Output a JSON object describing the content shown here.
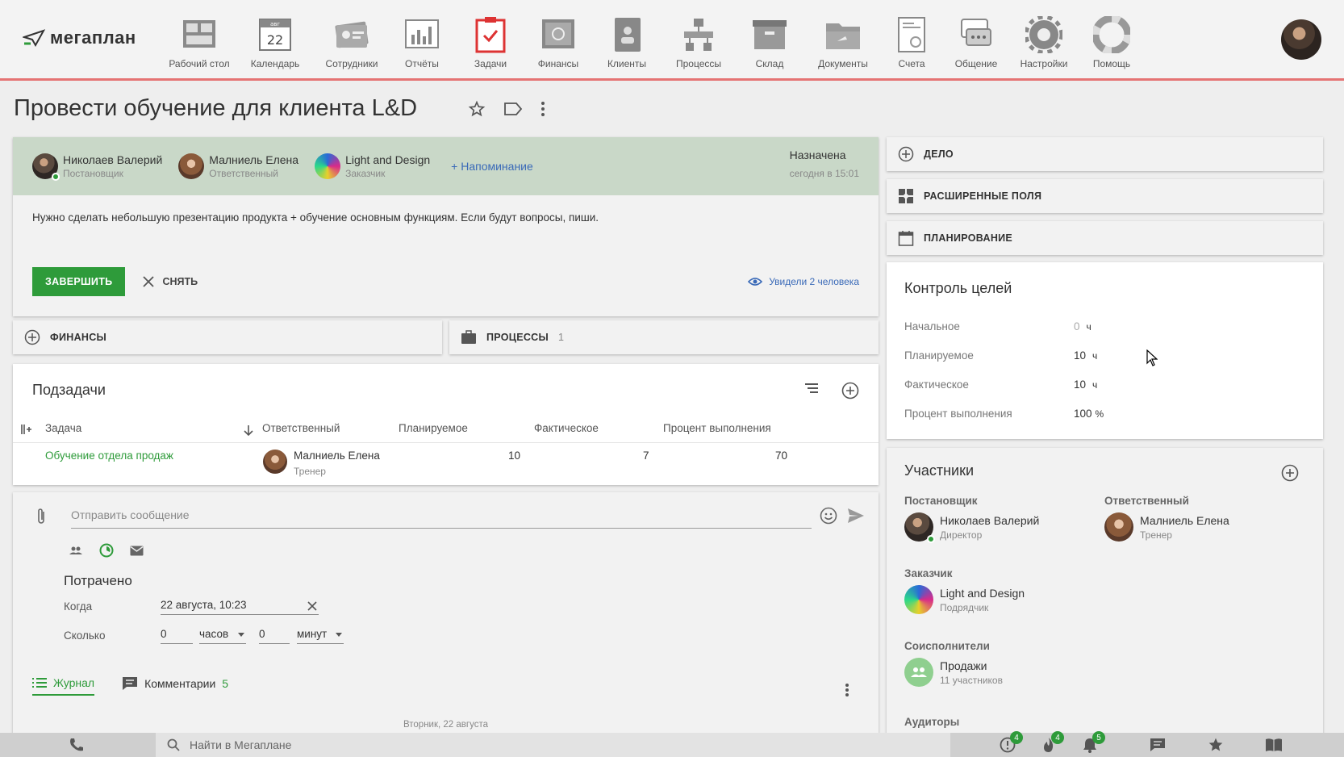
{
  "brand": {
    "logo_text": "мегаплан"
  },
  "nav": [
    {
      "label": "Рабочий стол",
      "icon": "desktop-icon"
    },
    {
      "label": "Календарь",
      "icon": "calendar-icon",
      "cal_month": "авг",
      "cal_day": "22"
    },
    {
      "label": "Сотрудники",
      "icon": "employees-icon"
    },
    {
      "label": "Отчёты",
      "icon": "reports-icon"
    },
    {
      "label": "Задачи",
      "icon": "tasks-icon"
    },
    {
      "label": "Финансы",
      "icon": "finance-icon"
    },
    {
      "label": "Клиенты",
      "icon": "clients-icon"
    },
    {
      "label": "Процессы",
      "icon": "processes-icon"
    },
    {
      "label": "Склад",
      "icon": "warehouse-icon"
    },
    {
      "label": "Документы",
      "icon": "documents-icon"
    },
    {
      "label": "Счета",
      "icon": "invoices-icon"
    },
    {
      "label": "Общение",
      "icon": "chat-icon"
    },
    {
      "label": "Настройки",
      "icon": "settings-icon"
    },
    {
      "label": "Помощь",
      "icon": "help-icon"
    }
  ],
  "page": {
    "title": "Провести обучение для клиента L&D"
  },
  "task": {
    "people": [
      {
        "name": "Николаев Валерий",
        "role": "Постановщик",
        "online": true
      },
      {
        "name": "Малниель Елена",
        "role": "Ответственный"
      },
      {
        "name": "Light and Design",
        "role": "Заказчик"
      }
    ],
    "reminder": "+ Напоминание",
    "status": "Назначена",
    "status_time": "сегодня в 15:01",
    "description": "Нужно сделать небольшую презентацию продукта + обучение основным функциям. Если будут вопросы, пиши.",
    "finish_label": "ЗАВЕРШИТЬ",
    "remove_label": "СНЯТЬ",
    "seen": "Увидели 2 человека"
  },
  "bars": {
    "finance": "ФИНАНСЫ",
    "processes": "ПРОЦЕССЫ",
    "processes_count": "1",
    "deal": "ДЕЛО",
    "ext_fields": "РАСШИРЕННЫЕ ПОЛЯ",
    "planning": "ПЛАНИРОВАНИЕ"
  },
  "subtasks": {
    "title": "Подзадачи",
    "columns": [
      "Задача",
      "Ответственный",
      "Планируемое",
      "Фактическое",
      "Процент выполнения"
    ],
    "rows": [
      {
        "task": "Обучение отдела продаж",
        "person": "Малниель Елена",
        "role": "Тренер",
        "planned": "10",
        "actual": "7",
        "percent": "70"
      }
    ]
  },
  "composer": {
    "placeholder": "Отправить сообщение",
    "spent_title": "Потрачено",
    "when_label": "Когда",
    "when_value": "22 августа, 10:23",
    "how_much_label": "Сколько",
    "hours_value": "0",
    "hours_unit": "часов",
    "minutes_value": "0",
    "minutes_unit": "минут"
  },
  "feed_tabs": [
    {
      "label": "Журнал",
      "active": true
    },
    {
      "label": "Комментарии",
      "count": "5"
    }
  ],
  "date_separator": "Вторник, 22 августа",
  "goals": {
    "title": "Контроль целей",
    "rows": [
      {
        "label": "Начальное",
        "value": "0",
        "unit": "ч"
      },
      {
        "label": "Планируемое",
        "value": "10",
        "unit": "ч"
      },
      {
        "label": "Фактическое",
        "value": "10",
        "unit": "ч"
      },
      {
        "label": "Процент выполнения",
        "value": "100",
        "unit": "%"
      }
    ]
  },
  "members": {
    "title": "Участники",
    "setter_label": "Постановщик",
    "setter": {
      "name": "Николаев Валерий",
      "role": "Директор"
    },
    "responsible_label": "Ответственный",
    "responsible": {
      "name": "Малниель Елена",
      "role": "Тренер"
    },
    "customer_label": "Заказчик",
    "customer": {
      "name": "Light and Design",
      "role": "Подрядчик"
    },
    "coexec_label": "Соисполнители",
    "coexec": {
      "name": "Продажи",
      "role": "11 участников"
    },
    "auditors_label": "Аудиторы"
  },
  "bottom": {
    "search_placeholder": "Найти в Мегаплане",
    "badges": {
      "alerts": "4",
      "hot": "4",
      "notifications": "5"
    }
  },
  "colors": {
    "accent_green": "#2e9b3a",
    "link_blue": "#3a6ab8",
    "nav_underline": "#e57373",
    "task_header": "#c9d8c8"
  }
}
